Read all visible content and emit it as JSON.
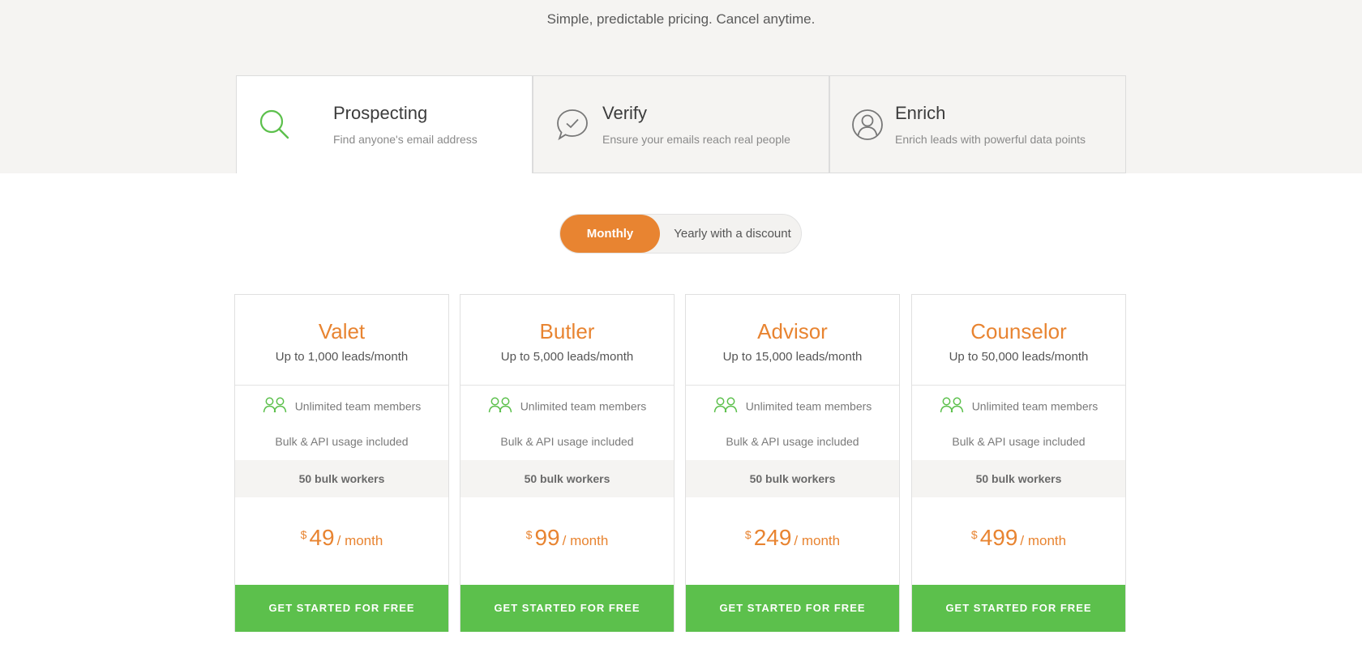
{
  "header": {
    "tagline": "Simple, predictable pricing. Cancel anytime."
  },
  "tabs": [
    {
      "title": "Prospecting",
      "subtitle": "Find anyone's email address",
      "icon": "search-icon",
      "active": true
    },
    {
      "title": "Verify",
      "subtitle": "Ensure your emails reach real people",
      "icon": "verify-bubble-icon",
      "active": false
    },
    {
      "title": "Enrich",
      "subtitle": "Enrich leads with powerful data points",
      "icon": "user-icon",
      "active": false
    }
  ],
  "billing_toggle": {
    "monthly_label": "Monthly",
    "yearly_label": "Yearly with a discount",
    "selected": "Monthly"
  },
  "plans": [
    {
      "name": "Valet",
      "leads": "Up to 1,000 leads/month",
      "team": "Unlimited team members",
      "bulk": "Bulk & API usage included",
      "workers": "50 bulk workers",
      "currency": "$",
      "price": "49",
      "period": "/ month",
      "cta": "GET STARTED FOR FREE"
    },
    {
      "name": "Butler",
      "leads": "Up to 5,000 leads/month",
      "team": "Unlimited team members",
      "bulk": "Bulk & API usage included",
      "workers": "50 bulk workers",
      "currency": "$",
      "price": "99",
      "period": "/ month",
      "cta": "GET STARTED FOR FREE"
    },
    {
      "name": "Advisor",
      "leads": "Up to 15,000 leads/month",
      "team": "Unlimited team members",
      "bulk": "Bulk & API usage included",
      "workers": "50 bulk workers",
      "currency": "$",
      "price": "249",
      "period": "/ month",
      "cta": "GET STARTED FOR FREE"
    },
    {
      "name": "Counselor",
      "leads": "Up to 50,000 leads/month",
      "team": "Unlimited team members",
      "bulk": "Bulk & API usage included",
      "workers": "50 bulk workers",
      "currency": "$",
      "price": "499",
      "period": "/ month",
      "cta": "GET STARTED FOR FREE"
    }
  ],
  "colors": {
    "accent": "#e88431",
    "cta": "#5cc04c",
    "icon_green": "#5cc04c",
    "band": "#f5f4f2"
  }
}
